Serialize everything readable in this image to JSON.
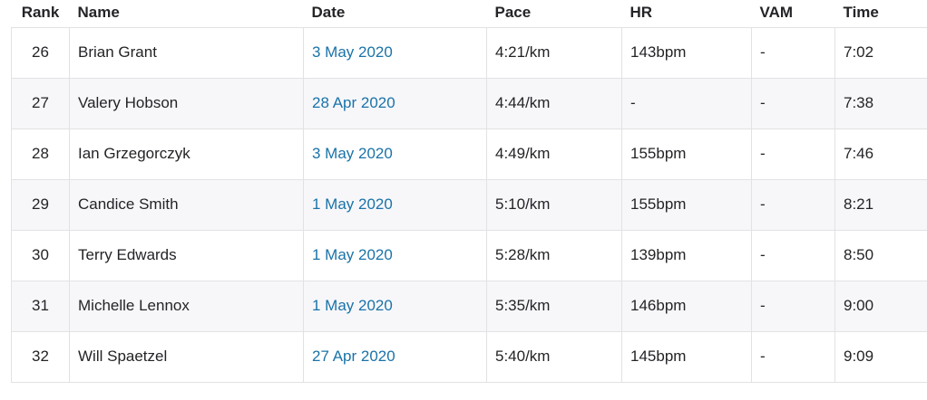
{
  "table": {
    "headers": {
      "rank": "Rank",
      "name": "Name",
      "date": "Date",
      "pace": "Pace",
      "hr": "HR",
      "vam": "VAM",
      "time": "Time"
    },
    "rows": [
      {
        "rank": "26",
        "name": "Brian Grant",
        "date": "3 May 2020",
        "pace": "4:21/km",
        "hr": "143bpm",
        "vam": "-",
        "time": "7:02"
      },
      {
        "rank": "27",
        "name": "Valery Hobson",
        "date": "28 Apr 2020",
        "pace": "4:44/km",
        "hr": "-",
        "vam": "-",
        "time": "7:38"
      },
      {
        "rank": "28",
        "name": "Ian Grzegorczyk",
        "date": "3 May 2020",
        "pace": "4:49/km",
        "hr": "155bpm",
        "vam": "-",
        "time": "7:46"
      },
      {
        "rank": "29",
        "name": "Candice Smith",
        "date": "1 May 2020",
        "pace": "5:10/km",
        "hr": "155bpm",
        "vam": "-",
        "time": "8:21"
      },
      {
        "rank": "30",
        "name": "Terry Edwards",
        "date": "1 May 2020",
        "pace": "5:28/km",
        "hr": "139bpm",
        "vam": "-",
        "time": "8:50"
      },
      {
        "rank": "31",
        "name": "Michelle Lennox",
        "date": "1 May 2020",
        "pace": "5:35/km",
        "hr": "146bpm",
        "vam": "-",
        "time": "9:00"
      },
      {
        "rank": "32",
        "name": "Will Spaetzel",
        "date": "27 Apr 2020",
        "pace": "5:40/km",
        "hr": "145bpm",
        "vam": "-",
        "time": "9:09"
      }
    ]
  },
  "colors": {
    "text": "#242428",
    "link": "#1a73a8",
    "border": "#e2e2e5",
    "stripe": "#f7f7fa"
  }
}
